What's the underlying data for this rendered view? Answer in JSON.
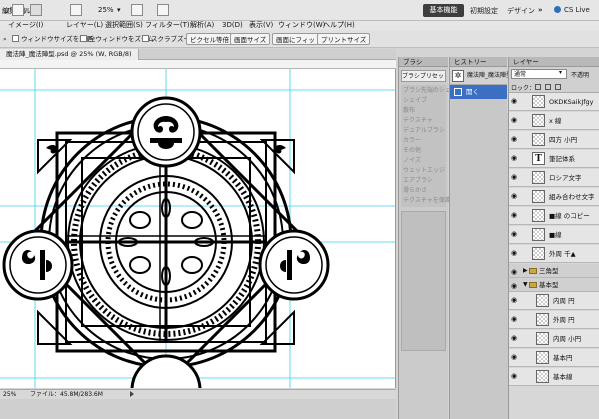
{
  "menubar": {
    "logo": "Ps",
    "items": [
      "ファイル(F)",
      "編集(E)",
      "イメージ(I)",
      "レイヤー(L)",
      "選択範囲(S)",
      "フィルター(T)",
      "解析(A)",
      "3D(D)",
      "表示(V)",
      "ウィンドウ(W)",
      "ヘルプ(H)"
    ],
    "zoom": "25%",
    "workspace_active": "基本機能",
    "workspace_options": [
      "初期設定",
      "デザイン"
    ],
    "more": "»",
    "cslive": "CS Live"
  },
  "options_bar": {
    "resize_windows": "ウィンドウサイズを変更",
    "zoom_all_windows": "全ウィンドウをズーム",
    "scrubby_zoom": "スクラブズーム",
    "actual_pixels": "ピクセル等倍",
    "fit_screen": "画面サイズ",
    "fill_screen": "画面にフィット",
    "print_size": "プリントサイズ"
  },
  "document": {
    "tab_title": "魔法陣_魔法陣型.psd @ 25% (W, RGB/8)",
    "zoom_status": "25%",
    "file_info": "ファイル：45.8M/283.6M"
  },
  "brush_panel": {
    "tab": "ブラシ",
    "preset_button": "ブラシプリセット",
    "items": [
      "ブラシ先端のシェイプ",
      "シェイプ",
      "散布",
      "テクスチャ",
      "デュアルブラシ",
      "カラー",
      "その他",
      "ノイズ",
      "ウェットエッジ",
      "エアブラシ",
      "滑らかさ",
      "テクスチャを保護"
    ]
  },
  "history_panel": {
    "tab": "ヒストリー",
    "snapshot": "魔法陣_魔法陣型",
    "state": "開く"
  },
  "layers_panel": {
    "tab": "レイヤー",
    "blend_mode": "通常",
    "opacity_label": "不透明",
    "lock_label": "ロック：",
    "layers": [
      {
        "name": "OKDKSaikJfgy",
        "kind": "pixel"
      },
      {
        "name": "x 線",
        "kind": "pixel"
      },
      {
        "name": "四方 小円",
        "kind": "pixel"
      },
      {
        "name": "筆記体系",
        "kind": "text"
      },
      {
        "name": "ロシア文字",
        "kind": "pixel"
      },
      {
        "name": "組み合わせ文字",
        "kind": "pixel"
      },
      {
        "name": "■線 のコピー",
        "kind": "pixel"
      },
      {
        "name": "■線",
        "kind": "pixel"
      },
      {
        "name": "外周 千▲",
        "kind": "pixel"
      },
      {
        "name": "三角型",
        "kind": "group"
      },
      {
        "name": "基本型",
        "kind": "group"
      },
      {
        "name": "内周 円",
        "kind": "pixel"
      },
      {
        "name": "外周 円",
        "kind": "pixel"
      },
      {
        "name": "内周 小円",
        "kind": "pixel"
      },
      {
        "name": "基本円",
        "kind": "pixel"
      },
      {
        "name": "基本線",
        "kind": "pixel"
      }
    ]
  }
}
